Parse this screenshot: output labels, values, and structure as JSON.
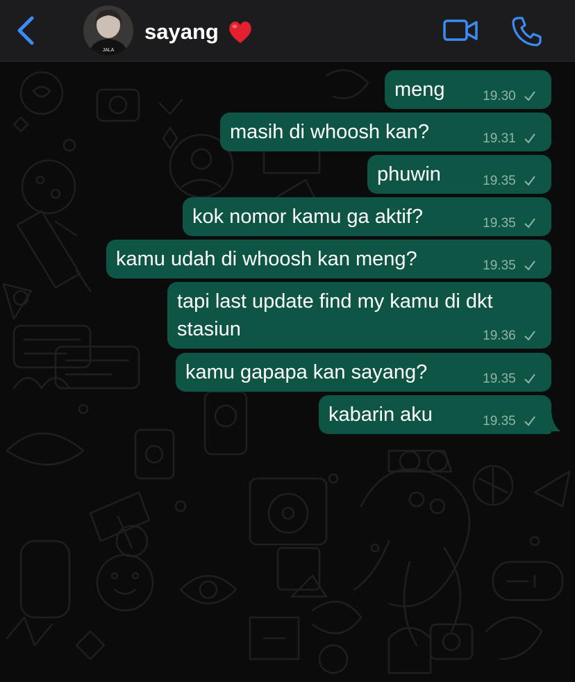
{
  "header": {
    "contact_name": "sayang",
    "back_icon": "chevron-left-icon",
    "video_icon": "video-camera-icon",
    "call_icon": "phone-icon",
    "heart_emoji": "❤️",
    "avatar_caption": "JALA",
    "accent_color": "#3b8cf5"
  },
  "chat": {
    "bubble_color": "#0f5546",
    "background_color": "#0b0b0c",
    "messages": [
      {
        "text": "meng",
        "time": "19.30",
        "status": "sent"
      },
      {
        "text": "masih di whoosh kan?",
        "time": "19.31",
        "status": "sent"
      },
      {
        "text": "phuwin",
        "time": "19.35",
        "status": "sent"
      },
      {
        "text": "kok nomor kamu ga aktif?",
        "time": "19.35",
        "status": "sent"
      },
      {
        "text": "kamu udah di whoosh kan meng?",
        "time": "19.35",
        "status": "sent"
      },
      {
        "line1": "tapi last update find my kamu di dkt",
        "line2": "stasiun",
        "time": "19.36",
        "status": "sent"
      },
      {
        "text": "kamu gapapa kan sayang?",
        "time": "19.35",
        "status": "sent"
      },
      {
        "text": "kabarin aku",
        "time": "19.35",
        "status": "sent"
      }
    ]
  }
}
